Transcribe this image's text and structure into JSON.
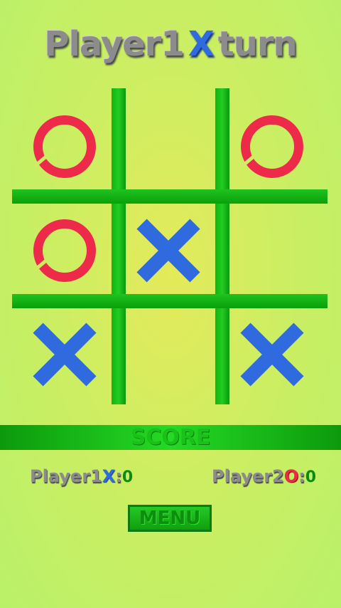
{
  "header": {
    "prefix": "Player1",
    "mark": "X",
    "suffix": "turn"
  },
  "board": {
    "cells": [
      {
        "mark": "O"
      },
      {
        "mark": ""
      },
      {
        "mark": "O"
      },
      {
        "mark": "O"
      },
      {
        "mark": "X"
      },
      {
        "mark": ""
      },
      {
        "mark": "X"
      },
      {
        "mark": ""
      },
      {
        "mark": "X"
      }
    ]
  },
  "score": {
    "title": "SCORE",
    "player1": {
      "label": "Player1",
      "mark": "X",
      "value": "0"
    },
    "player2": {
      "label": "Player2",
      "mark": "O",
      "value": "0"
    }
  },
  "menu": {
    "label": "MENU"
  },
  "colors": {
    "x": "#2f6bde",
    "o": "#ee2a4a",
    "grid": "#1fc21f",
    "background": "#cdee62"
  },
  "icons": {
    "x": "cross-icon",
    "o": "ring-icon"
  }
}
